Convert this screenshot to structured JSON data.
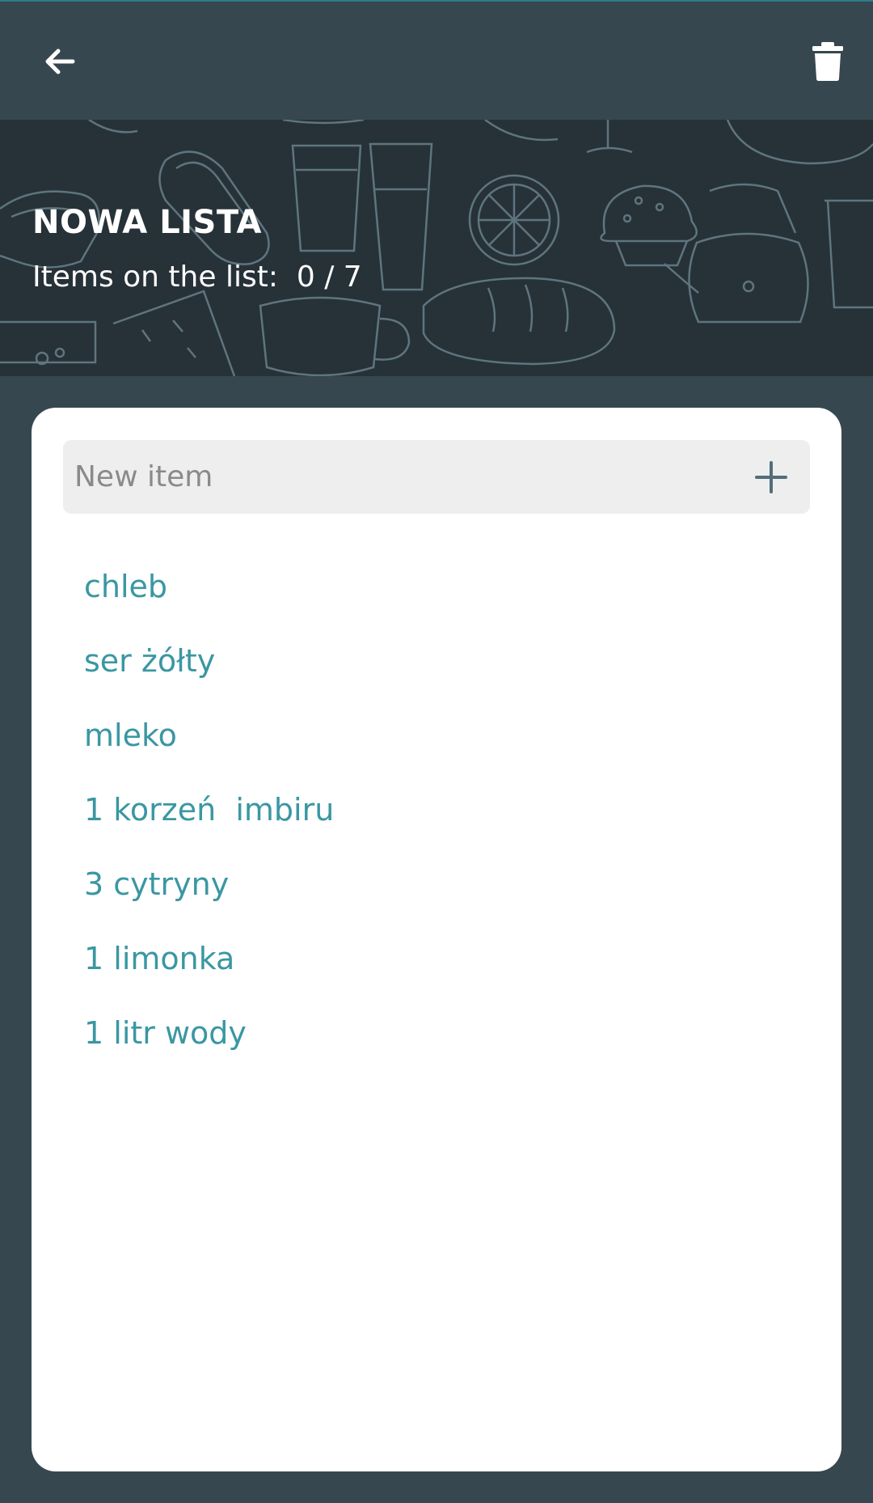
{
  "list": {
    "title": "NOWA LISTA",
    "count_text": "Items on the list:  0 / 7"
  },
  "toolbar": {
    "back_icon": "arrow-left-icon",
    "delete_icon": "trash-icon"
  },
  "new_item": {
    "placeholder": "New item",
    "value": "",
    "add_icon": "plus-icon"
  },
  "items": [
    "chleb",
    "ser żółty",
    "mleko",
    "1 korzeń  imbiru",
    "3 cytryny",
    "1 limonka",
    "1 litr wody"
  ],
  "colors": {
    "background": "#37474f",
    "hero_background": "#263238",
    "card": "#ffffff",
    "item_text": "#3a97a2",
    "input_background": "#eeeeee"
  }
}
